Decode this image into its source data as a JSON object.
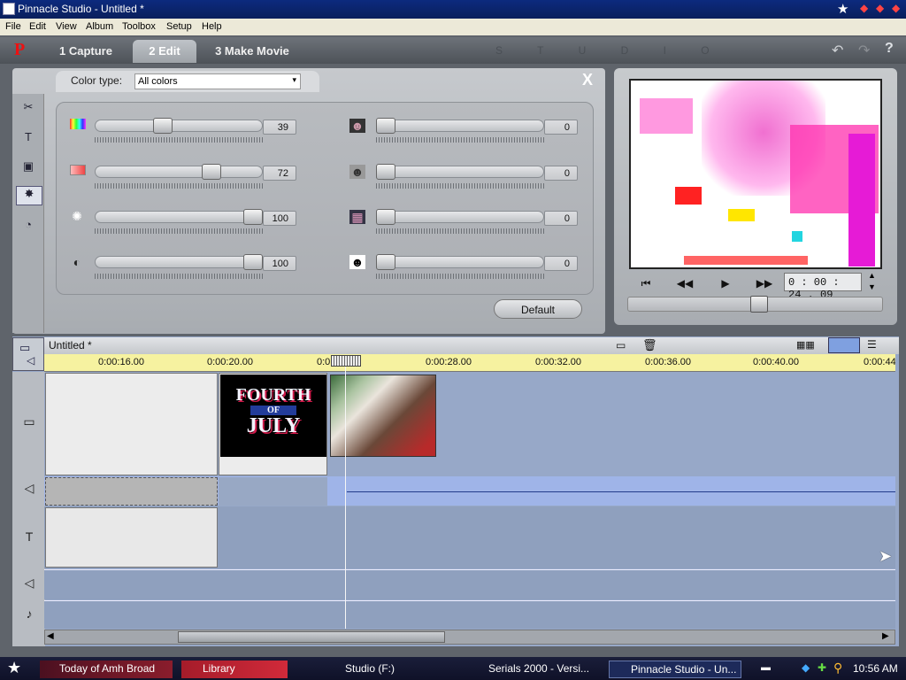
{
  "window": {
    "title": "Pinnacle Studio - Untitled *"
  },
  "menu": [
    "File",
    "Edit",
    "View",
    "Album",
    "Toolbox",
    "Setup",
    "Help"
  ],
  "mode_tabs": [
    {
      "label": "1 Capture"
    },
    {
      "label": "2 Edit"
    },
    {
      "label": "3 Make Movie"
    }
  ],
  "active_tab": "2 Edit",
  "studio_label": "S T U D I O",
  "color_panel": {
    "color_type_label": "Color type:",
    "color_type_value": "All colors",
    "default_label": "Default",
    "close_label": "X",
    "left_sliders": [
      {
        "icon": "hue-icon",
        "value": "39",
        "level": 39
      },
      {
        "icon": "saturation-icon",
        "value": "72",
        "level": 72
      },
      {
        "icon": "brightness-icon",
        "value": "100",
        "level": 100
      },
      {
        "icon": "contrast-icon",
        "value": "100",
        "level": 100
      }
    ],
    "right_sliders": [
      {
        "icon": "effect-blur-icon",
        "value": "0",
        "level": 0
      },
      {
        "icon": "effect-emboss-icon",
        "value": "0",
        "level": 0
      },
      {
        "icon": "effect-mosaic-icon",
        "value": "0",
        "level": 0
      },
      {
        "icon": "effect-posterize-icon",
        "value": "0",
        "level": 0
      }
    ]
  },
  "player": {
    "timecode": "0 : 00 : 24 . 09"
  },
  "timeline": {
    "project_name": "Untitled *",
    "ruler_labels": [
      "0:00:16.00",
      "0:00:20.00",
      "0:0",
      "0:00:28.00",
      "0:00:32.00",
      "0:00:36.00",
      "0:00:40.00",
      "0:00:44"
    ],
    "title_clip_text": [
      "FOURTH",
      "OF",
      "JULY"
    ]
  },
  "taskbar": {
    "items": [
      "Today of Amh Broad",
      "Library",
      "Studio (F:)",
      "Serials 2000 - Versi...",
      "Pinnacle Studio - Un..."
    ],
    "clock": "10:56 AM"
  },
  "colors": {
    "accent": "#0c2a7e",
    "timeline_blue": "#97a8c8",
    "ruler_yellow": "#f6f2a0"
  }
}
